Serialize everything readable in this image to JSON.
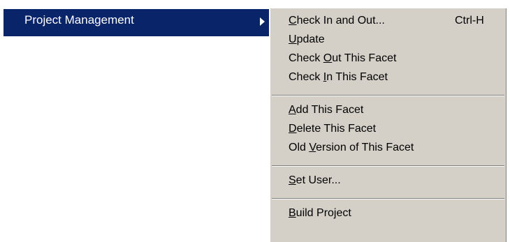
{
  "parent_menu": {
    "label": "Project Management"
  },
  "submenu": {
    "items": [
      {
        "pre": "",
        "acc": "C",
        "post": "heck In and Out...",
        "shortcut": "Ctrl-H"
      },
      {
        "pre": "",
        "acc": "U",
        "post": "pdate",
        "shortcut": ""
      },
      {
        "pre": "Check ",
        "acc": "O",
        "post": "ut This Facet",
        "shortcut": ""
      },
      {
        "pre": "Check ",
        "acc": "I",
        "post": "n This Facet",
        "shortcut": ""
      },
      {
        "pre": "",
        "acc": "A",
        "post": "dd This Facet",
        "shortcut": ""
      },
      {
        "pre": "",
        "acc": "D",
        "post": "elete This Facet",
        "shortcut": ""
      },
      {
        "pre": "Old ",
        "acc": "V",
        "post": "ersion of This Facet",
        "shortcut": ""
      },
      {
        "pre": "",
        "acc": "S",
        "post": "et User...",
        "shortcut": ""
      },
      {
        "pre": "",
        "acc": "B",
        "post": "uild Project",
        "shortcut": ""
      }
    ]
  }
}
